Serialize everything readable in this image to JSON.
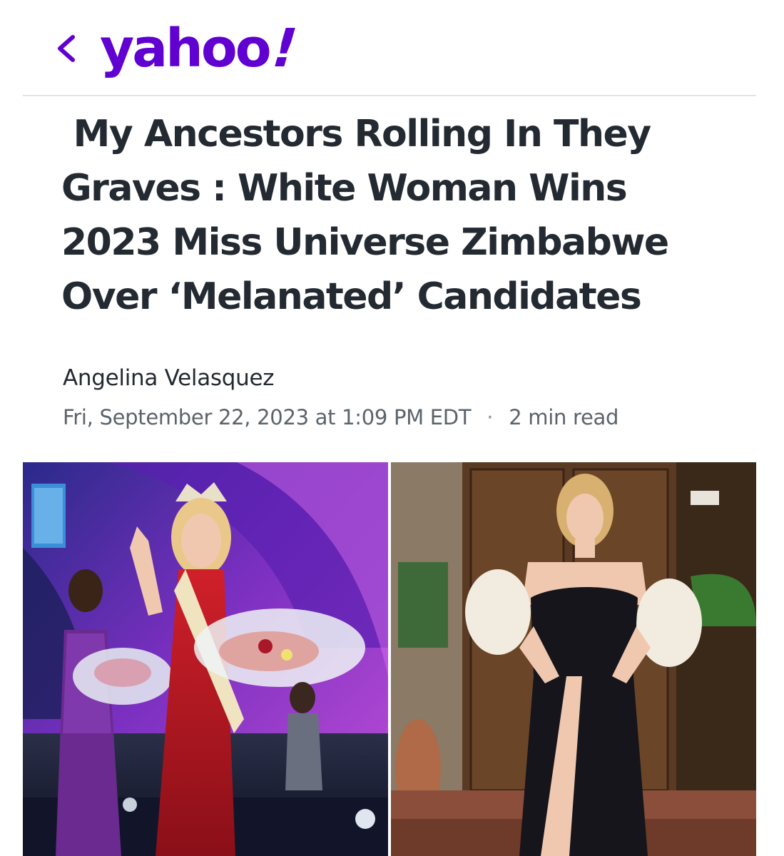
{
  "header": {
    "back_icon": "chevron-left-icon",
    "logo_text": "yahoo",
    "logo_mark": "!",
    "brand_color": "#6001d2"
  },
  "article": {
    "title": " My Ancestors Rolling In They Graves : White Woman Wins 2023 Miss Universe Zimbabwe Over ‘Melanated’ Candidates",
    "author": "Angelina Velasquez",
    "date": "Fri, September 22, 2023 at 1:09 PM EDT",
    "separator": "·",
    "read_time": "2 min read"
  },
  "images": {
    "left": "pageant-crowning-photo",
    "right": "black-gown-portrait-photo"
  }
}
